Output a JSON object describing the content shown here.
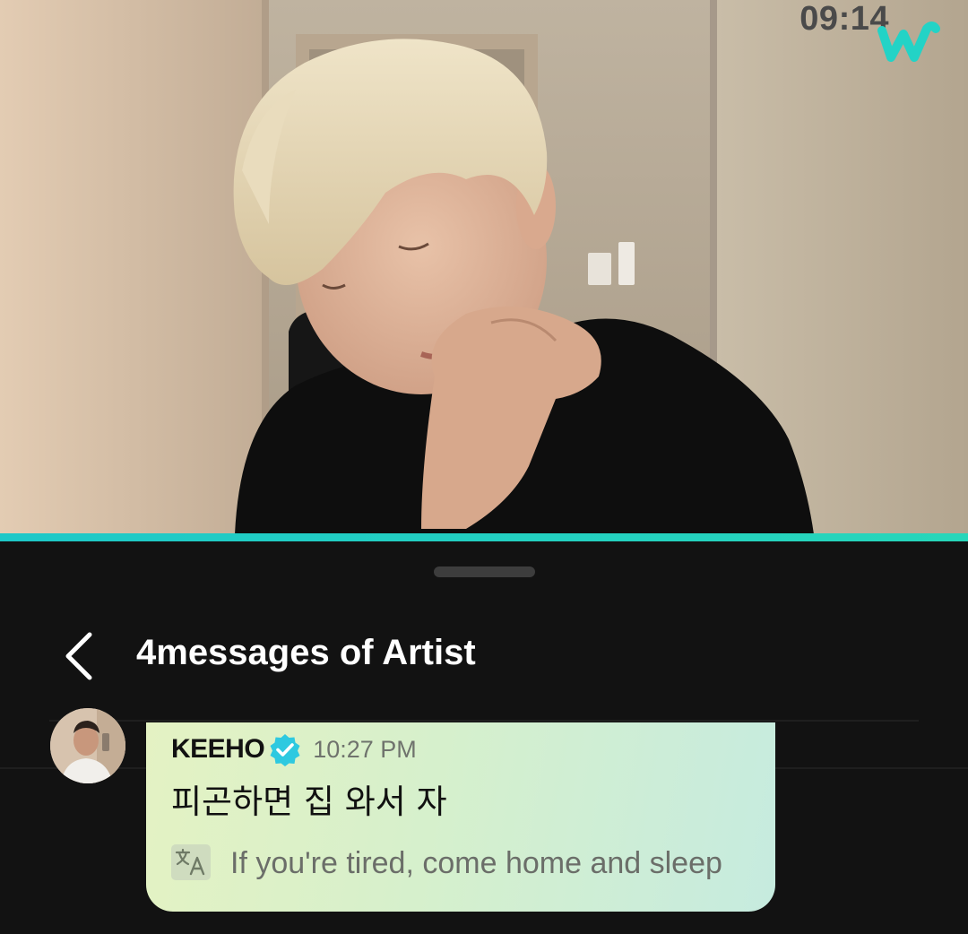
{
  "stream": {
    "timestamp": "09:14",
    "brand_icon": "weverse-w-logo",
    "progress_percent": 100
  },
  "sheet": {
    "title": "4messages of Artist",
    "back_icon": "chevron-left-icon"
  },
  "message": {
    "sender": "KEEHO",
    "verified_icon": "verified-badge-icon",
    "time": "10:27 PM",
    "text": "피곤하면 집 와서 자",
    "translate_icon": "translate-icon",
    "translation": "If you're tired, come home and sleep"
  },
  "colors": {
    "accent": "#1ec8c8",
    "background": "#121212",
    "bubble_start": "#e4f2c3",
    "bubble_end": "#c6ebdf",
    "verified": "#2ec9e0"
  }
}
